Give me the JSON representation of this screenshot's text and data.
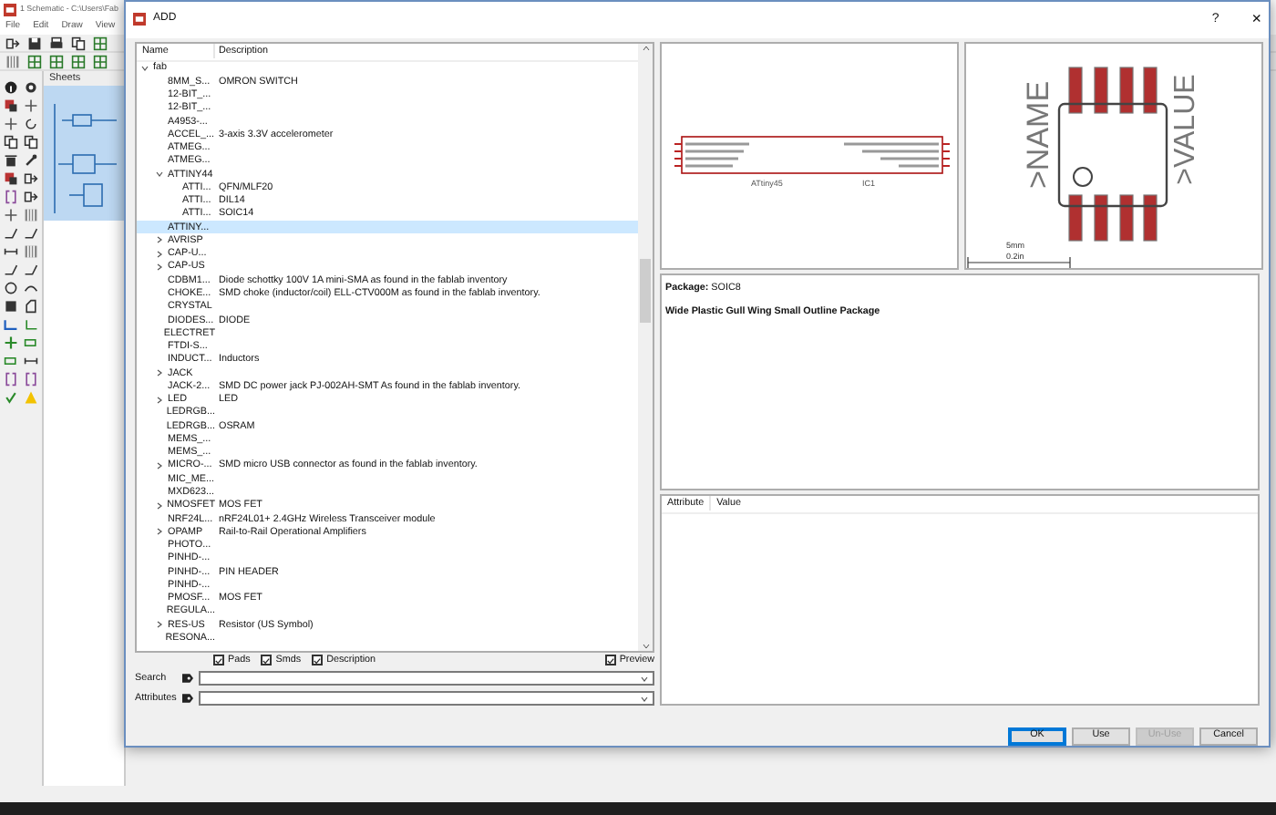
{
  "background_window": {
    "title": "1 Schematic - C:\\Users\\Fab",
    "menu": [
      "File",
      "Edit",
      "Draw",
      "View"
    ],
    "sheets_label": "Sheets"
  },
  "dialog": {
    "title": "ADD",
    "help": "?",
    "close": "×"
  },
  "library": {
    "columns": [
      "Name",
      "Description"
    ],
    "tree": [
      {
        "name": "fab",
        "expanded": true,
        "selected": false,
        "children": [
          {
            "name": "8MM_S...",
            "description": "OMRON SWITCH",
            "selected": false
          },
          {
            "name": "12-BIT_...",
            "selected": false
          },
          {
            "name": "12-BIT_...",
            "selected": false
          },
          {
            "name": "A4953-...",
            "selected": false
          },
          {
            "name": "ACCEL_...",
            "description": "3-axis 3.3V accelerometer",
            "selected": false
          },
          {
            "name": "ATMEG...",
            "selected": false
          },
          {
            "name": "ATMEG...",
            "selected": false
          },
          {
            "name": "ATTINY44",
            "expanded": true,
            "selected": false,
            "children": [
              {
                "name": "ATTI...",
                "description": "QFN/MLF20",
                "selected": false
              },
              {
                "name": "ATTI...",
                "description": "DIL14",
                "selected": false
              },
              {
                "name": "ATTI...",
                "description": "SOIC14",
                "selected": false
              }
            ]
          },
          {
            "name": "ATTINY...",
            "selected": true
          },
          {
            "name": "AVRISP",
            "expanded": false,
            "selected": false
          },
          {
            "name": "CAP-U...",
            "expanded": false,
            "selected": false
          },
          {
            "name": "CAP-US",
            "expanded": false,
            "selected": false
          },
          {
            "name": "CDBM1...",
            "description": "Diode schottky 100V 1A mini-SMA as found in the fablab inventory",
            "selected": false
          },
          {
            "name": "CHOKE...",
            "description": "SMD choke (inductor/coil) ELL-CTV000M as found in the fablab inventory.",
            "selected": false
          },
          {
            "name": "CRYSTAL",
            "selected": false
          },
          {
            "name": "DIODES...",
            "description": "DIODE",
            "selected": false
          },
          {
            "name": "ELECTRET",
            "selected": false
          },
          {
            "name": "FTDI-S...",
            "selected": false
          },
          {
            "name": "INDUCT...",
            "description": "Inductors",
            "selected": false
          },
          {
            "name": "JACK",
            "expanded": false,
            "selected": false
          },
          {
            "name": "JACK-2...",
            "description": "SMD DC power jack PJ-002AH-SMT As found in the fablab inventory.",
            "selected": false
          },
          {
            "name": "LED",
            "expanded": false,
            "description": "LED",
            "selected": false
          },
          {
            "name": "LEDRGB...",
            "selected": false
          },
          {
            "name": "LEDRGB...",
            "description": "OSRAM",
            "selected": false
          },
          {
            "name": "MEMS_...",
            "selected": false
          },
          {
            "name": "MEMS_...",
            "selected": false
          },
          {
            "name": "MICRO-...",
            "expanded": false,
            "description": "SMD micro USB connector as found in the fablab inventory.",
            "selected": false
          },
          {
            "name": "MIC_ME...",
            "selected": false
          },
          {
            "name": "MXD623...",
            "selected": false
          },
          {
            "name": "NMOSFET",
            "expanded": false,
            "description": "MOS FET",
            "selected": false
          },
          {
            "name": "NRF24L...",
            "description": "nRF24L01+ 2.4GHz Wireless Transceiver module",
            "selected": false
          },
          {
            "name": "OPAMP",
            "expanded": false,
            "description": "Rail-to-Rail Operational Amplifiers",
            "selected": false
          },
          {
            "name": "PHOTO...",
            "selected": false
          },
          {
            "name": "PINHD-...",
            "selected": false
          },
          {
            "name": "PINHD-...",
            "description": "PIN HEADER",
            "selected": false
          },
          {
            "name": "PINHD-...",
            "selected": false
          },
          {
            "name": "PMOSF...",
            "description": "MOS FET",
            "selected": false
          },
          {
            "name": "REGULA...",
            "selected": false
          },
          {
            "name": "RES-US",
            "expanded": false,
            "description": "Resistor (US Symbol)",
            "selected": false
          },
          {
            "name": "RESONA...",
            "selected": false
          }
        ]
      }
    ]
  },
  "filters": [
    {
      "label": "Pads",
      "checked": true
    },
    {
      "label": "Smds",
      "checked": true
    },
    {
      "label": "Description",
      "checked": true
    }
  ],
  "preview_toggle": {
    "label": "Preview",
    "checked": true
  },
  "search": {
    "label": "Search"
  },
  "attributes_filter": {
    "label": "Attributes"
  },
  "symbol_preview": {
    "device": "ATtiny45",
    "part": "IC1"
  },
  "footprint_preview": {
    "name_label": ">NAME",
    "value_label": ">VALUE",
    "scale": [
      "5mm",
      "0.2in"
    ]
  },
  "description": {
    "package": "**Package:** SOIC8",
    "text": "Wide Plastic Gull Wing Small Outline Package"
  },
  "attribute_table": {
    "columns": [
      "Attribute",
      "Value"
    ]
  },
  "buttons": [
    {
      "label": "OK",
      "default": true,
      "disabled": false
    },
    {
      "label": "Use",
      "default": false,
      "disabled": false
    },
    {
      "label": "Un-Use",
      "default": false,
      "disabled": true
    },
    {
      "label": "Cancel",
      "default": false,
      "disabled": false
    }
  ]
}
